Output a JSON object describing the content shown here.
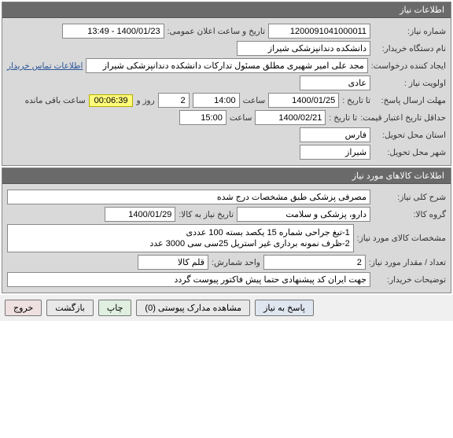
{
  "need_info": {
    "header": "اطلاعات نیاز",
    "labels": {
      "need_number": "شماره نیاز:",
      "public_announce": "تاریخ و ساعت اعلان عمومی:",
      "buyer_org": "نام دستگاه خریدار:",
      "request_creator": "ایجاد کننده درخواست:",
      "contact_link": "اطلاعات تماس خریدار",
      "priority": "اولویت نیاز :",
      "deadline": "مهلت ارسال پاسخ:",
      "to_date": "تا تاریخ :",
      "time": "ساعت",
      "days": "روز و",
      "remaining": "ساعت باقی مانده",
      "min_validity": "حداقل تاریخ اعتبار قیمت:",
      "delivery_province": "استان محل تحویل:",
      "delivery_city": "شهر محل تحویل:"
    },
    "values": {
      "need_number": "1200091041000011",
      "public_announce": "1400/01/23 - 13:49",
      "buyer_org": "دانشکده دندانپزشکی شیراز",
      "request_creator": "مجد علی امیر شهیری مطلق مسئول تدارکات دانشکده دندانپزشکی شیراز",
      "priority": "عادی",
      "deadline_date": "1400/01/25",
      "deadline_time": "14:00",
      "days_left": "2",
      "time_left": "00:06:39",
      "validity_date": "1400/02/21",
      "validity_time": "15:00",
      "province": "فارس",
      "city": "شیراز"
    }
  },
  "goods_info": {
    "header": "اطلاعات کالاهای مورد نیاز",
    "labels": {
      "overall_desc": "شرح کلی نیاز:",
      "goods_group": "گروه کالا:",
      "need_date": "تاریخ نیاز به کالا:",
      "goods_spec": "مشخصات کالای مورد نیاز:",
      "quantity": "تعداد / مقدار مورد نیاز:",
      "unit": "واحد شمارش:",
      "buyer_notes": "توضیحات خریدار:"
    },
    "values": {
      "overall_desc": "مصرفی پزشکی طبق مشخصات درج شده",
      "goods_group": "دارو، پزشکی و سلامت",
      "need_date": "1400/01/29",
      "goods_spec": "1-تیغ جراحی شماره 15 یکصد بسته 100 عددی\n2-ظرف نمونه برداری غیر استریل 25سی سی 3000 عدد",
      "quantity": "2",
      "unit": "قلم کالا",
      "buyer_notes": "جهت ایران کد پیشنهادی حتما پیش فاکتور پیوست گردد"
    }
  },
  "buttons": {
    "respond": "پاسخ به نیاز",
    "attachments": "مشاهده مدارک پیوستی (0)",
    "print": "چاپ",
    "back": "بازگشت",
    "exit": "خروج"
  }
}
